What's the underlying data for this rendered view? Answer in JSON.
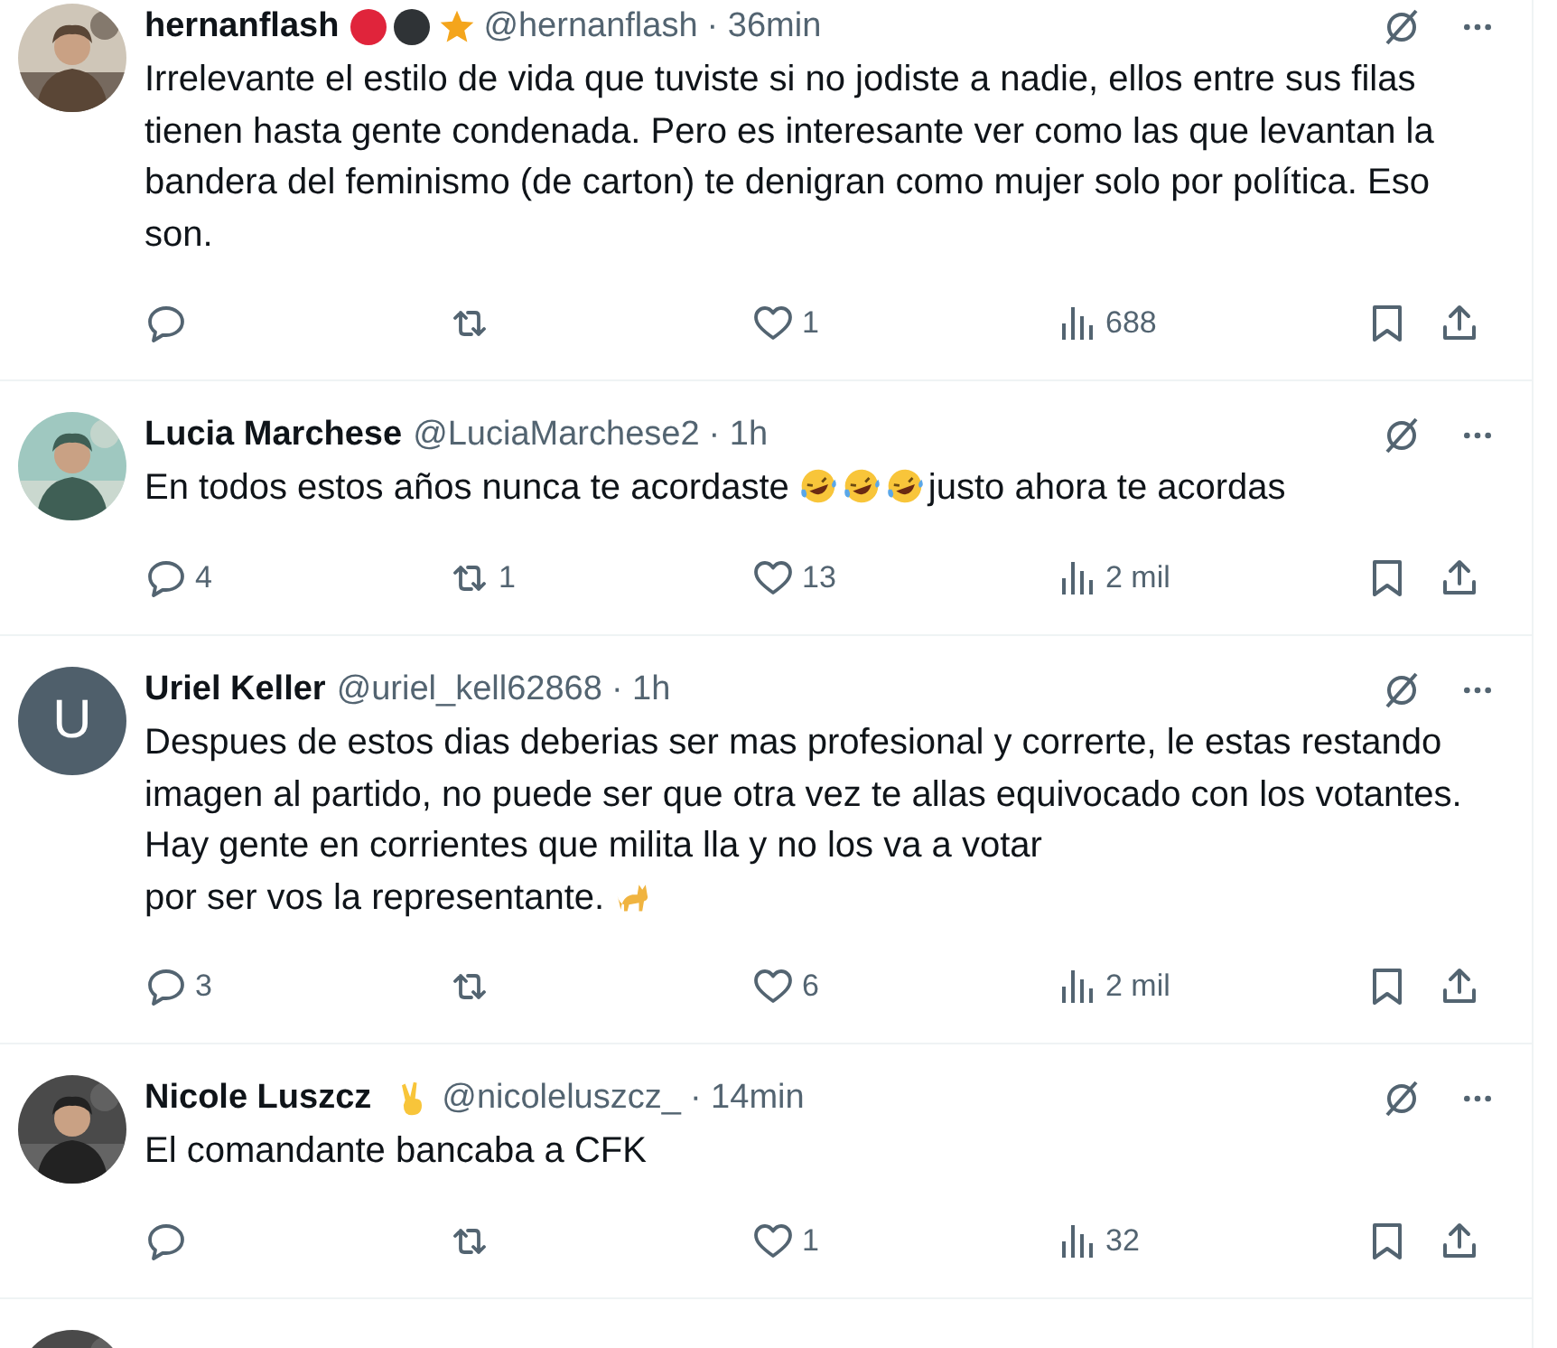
{
  "tweets": [
    {
      "avatar": {
        "kind": "picture"
      },
      "name": "hernanflash",
      "badges": [
        {
          "kind": "dot",
          "color": "#e0243b"
        },
        {
          "kind": "dot",
          "color": "#2f3336"
        },
        {
          "kind": "star"
        }
      ],
      "handle": "@hernanflash",
      "time": "· 36min",
      "body": [
        {
          "kind": "text",
          "text": "Irrelevante el estilo de vida que tuviste si no jodiste a nadie, ellos entre sus filas tienen hasta gente condenada. Pero es interesante ver como las que levantan la bandera del feminismo (de carton) te denigran como mujer solo por política. Eso son."
        }
      ],
      "actions": [
        {
          "kind": "reply"
        },
        {
          "kind": "retweet"
        },
        {
          "kind": "like",
          "count": "1"
        },
        {
          "kind": "views",
          "count": "688"
        },
        {
          "kind": "bookmark"
        },
        {
          "kind": "share"
        }
      ]
    },
    {
      "avatar": {
        "kind": "picture"
      },
      "name": "Lucia Marchese",
      "handle": "@LuciaMarchese2",
      "time": "· 1h",
      "body": [
        {
          "kind": "text",
          "text": "En todos estos años nunca te acordaste"
        },
        {
          "kind": "laugh"
        },
        {
          "kind": "laugh"
        },
        {
          "kind": "laugh"
        },
        {
          "kind": "text",
          "text": "justo ahora te acordas"
        }
      ],
      "actions": [
        {
          "kind": "reply",
          "count": "4"
        },
        {
          "kind": "retweet",
          "count": "1"
        },
        {
          "kind": "like",
          "count": "13"
        },
        {
          "kind": "views",
          "count": "2 mil"
        },
        {
          "kind": "bookmark"
        },
        {
          "kind": "share"
        }
      ]
    },
    {
      "avatar": {
        "kind": "letter",
        "letter": "U"
      },
      "name": "Uriel Keller",
      "handle": "@uriel_kell62868",
      "time": "· 1h",
      "body": [
        {
          "kind": "text",
          "text": "Despues de estos dias deberias ser mas profesional y correrte, le estas restando imagen al partido, no puede ser que otra vez te allas equivocado con los votantes. Hay gente en corrientes que milita lla y no los va a votar"
        },
        {
          "kind": "text",
          "text": "por ser vos la representante."
        },
        {
          "kind": "cat"
        }
      ],
      "actions": [
        {
          "kind": "reply",
          "count": "3"
        },
        {
          "kind": "retweet"
        },
        {
          "kind": "like",
          "count": "6"
        },
        {
          "kind": "views",
          "count": "2 mil"
        },
        {
          "kind": "bookmark"
        },
        {
          "kind": "share"
        }
      ]
    },
    {
      "avatar": {
        "kind": "picture"
      },
      "name": "Nicole Luszcz",
      "badges": [
        {
          "kind": "victory"
        }
      ],
      "handle": "@nicoleluszcz_",
      "time": "· 14min",
      "body": [
        {
          "kind": "text",
          "text": "El comandante bancaba a CFK"
        }
      ],
      "actions": [
        {
          "kind": "reply"
        },
        {
          "kind": "retweet"
        },
        {
          "kind": "like",
          "count": "1"
        },
        {
          "kind": "views",
          "count": "32"
        },
        {
          "kind": "bookmark"
        },
        {
          "kind": "share"
        }
      ]
    }
  ],
  "next_tweet": {
    "avatar": {
      "kind": "picture"
    }
  }
}
